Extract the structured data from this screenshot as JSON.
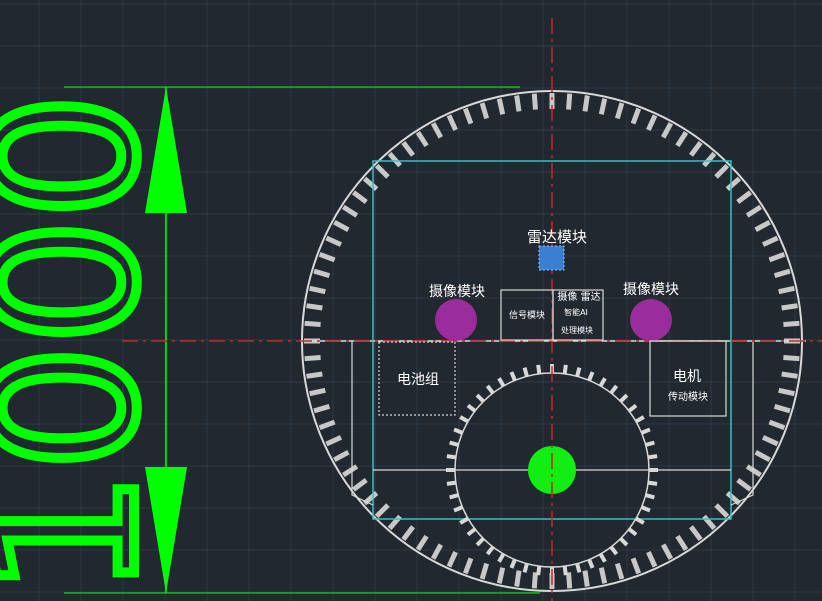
{
  "drawing": {
    "dimension": {
      "value": "1000"
    },
    "modules": {
      "radar": "雷达模块",
      "camera_left": "摄像模块",
      "camera_right": "摄像模块",
      "signal": "信号模块",
      "ai_title": "摄像 雷达",
      "ai_line2": "智能AI",
      "ai_line3": "处理模块",
      "battery": "电池组",
      "motor_title": "电机",
      "motor_sub": "传动模块"
    },
    "colors": {
      "background": "#212830",
      "grid": "#2f3a46",
      "dimension": "#00ff00",
      "centerline": "#cc2222",
      "frame": "#2fc4c4",
      "outline": "#d8d8d8",
      "camera": "#9b2c9b",
      "radar": "#3a7fd0",
      "hub": "#11ee11"
    }
  }
}
